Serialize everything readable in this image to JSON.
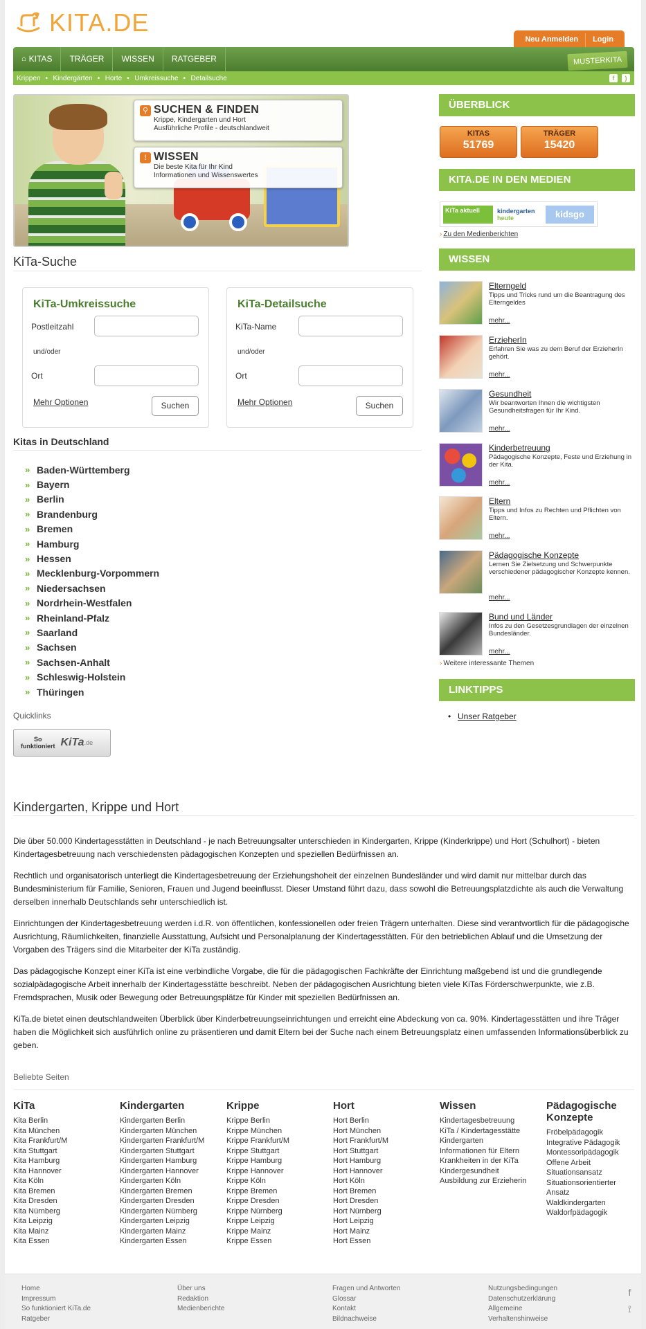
{
  "header": {
    "logo_text": "KITA.DE",
    "top_tabs": [
      "Neu Anmelden",
      "Login"
    ],
    "nav": [
      "KITAS",
      "TRÄGER",
      "WISSEN",
      "RATGEBER"
    ],
    "musterkita": "MUSTERKITA",
    "subnav": [
      "Krippen",
      "Kindergärten",
      "Horte",
      "Umkreissuche",
      "Detailsuche"
    ]
  },
  "hero": {
    "box1": {
      "title": "SUCHEN & FINDEN",
      "line1": "Krippe, Kindergarten und Hort",
      "line2": "Ausführliche Profile - deutschlandweit"
    },
    "box2": {
      "title": "WISSEN",
      "line1": "Die beste Kita für Ihr Kind",
      "line2": "Informationen und Wissenswertes"
    }
  },
  "search": {
    "section_title": "KiTa-Suche",
    "umkreis": {
      "title": "KiTa-Umkreissuche",
      "label1": "Postleitzahl",
      "andor": "und/oder",
      "label2": "Ort",
      "more": "Mehr Optionen",
      "button": "Suchen"
    },
    "detail": {
      "title": "KiTa-Detailsuche",
      "label1": "KiTa-Name",
      "andor": "und/oder",
      "label2": "Ort",
      "more": "Mehr Optionen",
      "button": "Suchen"
    }
  },
  "states": {
    "title": "Kitas in Deutschland",
    "items": [
      "Baden-Württemberg",
      "Bayern",
      "Berlin",
      "Brandenburg",
      "Bremen",
      "Hamburg",
      "Hessen",
      "Mecklenburg-Vorpommern",
      "Niedersachsen",
      "Nordrhein-Westfalen",
      "Rheinland-Pfalz",
      "Saarland",
      "Sachsen",
      "Sachsen-Anhalt",
      "Schleswig-Holstein",
      "Thüringen"
    ]
  },
  "quicklinks": {
    "title": "Quicklinks",
    "btn_line1": "So",
    "btn_line2": "funktioniert",
    "btn_brand": "KiTa",
    "btn_suffix": ".de"
  },
  "sidebar": {
    "overview_title": "ÜBERBLICK",
    "stats": [
      {
        "label": "KITAS",
        "value": "51769"
      },
      {
        "label": "TRÄGER",
        "value": "15420"
      }
    ],
    "media_title": "KITA.DE IN DEN MEDIEN",
    "media_logo1": "KiTa aktuell",
    "media_logo2a": "kindergarten",
    "media_logo2b": "heute",
    "media_logo3": "kidsgo",
    "media_link": "Zu den Medienberichten",
    "wissen_title": "WISSEN",
    "wissen": [
      {
        "title": "Elterngeld",
        "desc": "Tipps und Tricks rund um die Beantragung des Elterngeldes",
        "more": "mehr..."
      },
      {
        "title": "ErzieherIn",
        "desc": "Erfahren Sie was zu dem Beruf der ErzieherIn gehört.",
        "more": "mehr..."
      },
      {
        "title": "Gesundheit",
        "desc": "Wir beantworten Ihnen die wichtigsten Gesundheitsfragen für Ihr Kind.",
        "more": "mehr..."
      },
      {
        "title": "Kinderbetreuung",
        "desc": "Pädagogische Konzepte, Feste und Erziehung in der Kita.",
        "more": "mehr..."
      },
      {
        "title": "Eltern",
        "desc": "Tipps und Infos zu Rechten und Pflichten von Eltern.",
        "more": "mehr..."
      },
      {
        "title": "Pädagogische Konzepte",
        "desc": "Lernen Sie Zielsetzung und Schwerpunkte verschiedener pädagogischer Konzepte kennen.",
        "more": "mehr..."
      },
      {
        "title": "Bund und Länder",
        "desc": "Infos zu den Gesetzesgrundlagen der einzelnen Bundesländer.",
        "more": "mehr..."
      }
    ],
    "wissen_more": "Weitere interessante Themen",
    "linktipps_title": "LINKTIPPS",
    "linktipp": "Unser Ratgeber"
  },
  "article": {
    "title": "Kindergarten, Krippe und Hort",
    "paragraphs": [
      "Die über 50.000 Kindertagesstätten in Deutschland - je nach Betreuungsalter unterschieden in Kindergarten, Krippe (Kinderkrippe) und Hort (Schulhort) - bieten Kindertagesbetreuung nach verschiedensten pädagogischen Konzepten und speziellen Bedürfnissen an.",
      "Rechtlich und organisatorisch unterliegt die Kindertagesbetreuung der Erziehungshoheit der einzelnen Bundesländer und wird damit nur mittelbar durch das Bundesministerium für Familie, Senioren, Frauen und Jugend beeinflusst. Dieser Umstand führt dazu, dass sowohl die Betreuungsplatzdichte als auch die Verwaltung derselben innerhalb Deutschlands sehr unterschiedlich ist.",
      "Einrichtungen der Kindertagesbetreuung werden i.d.R. von öffentlichen, konfessionellen oder freien Trägern unterhalten. Diese sind verantwortlich für die pädagogische Ausrichtung, Räumlichkeiten, finanzielle Ausstattung, Aufsicht und Personalplanung der Kindertagesstätten. Für den betrieblichen Ablauf und die Umsetzung der Vorgaben des Trägers sind die Mitarbeiter der KiTa zuständig.",
      "Das pädagogische Konzept einer KiTa ist eine verbindliche Vorgabe, die für die pädagogischen Fachkräfte der Einrichtung maßgebend ist und die grundlegende sozialpädagogische Arbeit innerhalb der Kindertagesstätte beschreibt. Neben der pädagogischen Ausrichtung bieten viele KiTas Förderschwerpunkte, wie z.B. Fremdsprachen, Musik oder Bewegung oder Betreuungsplätze für Kinder mit speziellen Bedürfnissen an.",
      "KiTa.de bietet einen deutschlandweiten Überblick über Kinderbetreuungseinrichtungen und erreicht eine Abdeckung von ca. 90%. Kindertagesstätten und ihre Träger haben die Möglichkeit sich ausführlich online zu präsentieren und damit Eltern bei der Suche nach einem Betreuungsplatz einen umfassenden Informationsüberblick zu geben."
    ]
  },
  "popular": {
    "title": "Beliebte Seiten",
    "columns": [
      {
        "heading": "KiTa",
        "items": [
          "Kita Berlin",
          "Kita München",
          "Kita Frankfurt/M",
          "Kita Stuttgart",
          "Kita Hamburg",
          "Kita Hannover",
          "Kita Köln",
          "Kita Bremen",
          "Kita Dresden",
          "Kita Nürnberg",
          "Kita Leipzig",
          "Kita Mainz",
          "Kita Essen"
        ]
      },
      {
        "heading": "Kindergarten",
        "items": [
          "Kindergarten Berlin",
          "Kindergarten München",
          "Kindergarten Frankfurt/M",
          "Kindergarten Stuttgart",
          "Kindergarten Hamburg",
          "Kindergarten Hannover",
          "Kindergarten Köln",
          "Kindergarten Bremen",
          "Kindergarten Dresden",
          "Kindergarten Nürnberg",
          "Kindergarten Leipzig",
          "Kindergarten Mainz",
          "Kindergarten Essen"
        ]
      },
      {
        "heading": "Krippe",
        "items": [
          "Krippe Berlin",
          "Krippe München",
          "Krippe Frankfurt/M",
          "Krippe Stuttgart",
          "Krippe Hamburg",
          "Krippe Hannover",
          "Krippe Köln",
          "Krippe Bremen",
          "Krippe Dresden",
          "Krippe Nürnberg",
          "Krippe Leipzig",
          "Krippe Mainz",
          "Krippe Essen"
        ]
      },
      {
        "heading": "Hort",
        "items": [
          "Hort Berlin",
          "Hort München",
          "Hort Frankfurt/M",
          "Hort Stuttgart",
          "Hort Hamburg",
          "Hort Hannover",
          "Hort Köln",
          "Hort Bremen",
          "Hort Dresden",
          "Hort Nürnberg",
          "Hort Leipzig",
          "Hort Mainz",
          "Hort Essen"
        ]
      },
      {
        "heading": "Wissen",
        "items": [
          "Kindertagesbetreuung",
          "KiTa / Kindertagesstätte",
          "Kindergarten",
          "Informationen für Eltern",
          "Krankheiten in der KiTa",
          "Kindergesundheit",
          "Ausbildung zur Erzieherin"
        ]
      },
      {
        "heading": "Pädagogische Konzepte",
        "items": [
          "Fröbelpädagogik",
          "Integrative Pädagogik",
          "Montessoripädagogik",
          "Offene Arbeit",
          "Situationsansatz",
          "Situationsorientierter Ansatz",
          "Waldkindergarten",
          "Waldorfpädagogik"
        ]
      }
    ]
  },
  "footer": {
    "col1": [
      "Home",
      "Impressum",
      "So funktioniert KiTa.de",
      "Ratgeber"
    ],
    "col2": [
      "Über uns",
      "Redaktion",
      "Medienberichte"
    ],
    "col3": [
      "Fragen und Antworten",
      "Glossar",
      "Kontakt",
      "Bildnachweise"
    ],
    "col4": [
      "Nutzungsbedingungen",
      "Datenschutzerklärung",
      "Allgemeine",
      "Verhaltenshinweise"
    ]
  },
  "colors": {
    "green": "#8cc14a",
    "dark_green": "#4b7d2f",
    "orange": "#e57c27"
  }
}
